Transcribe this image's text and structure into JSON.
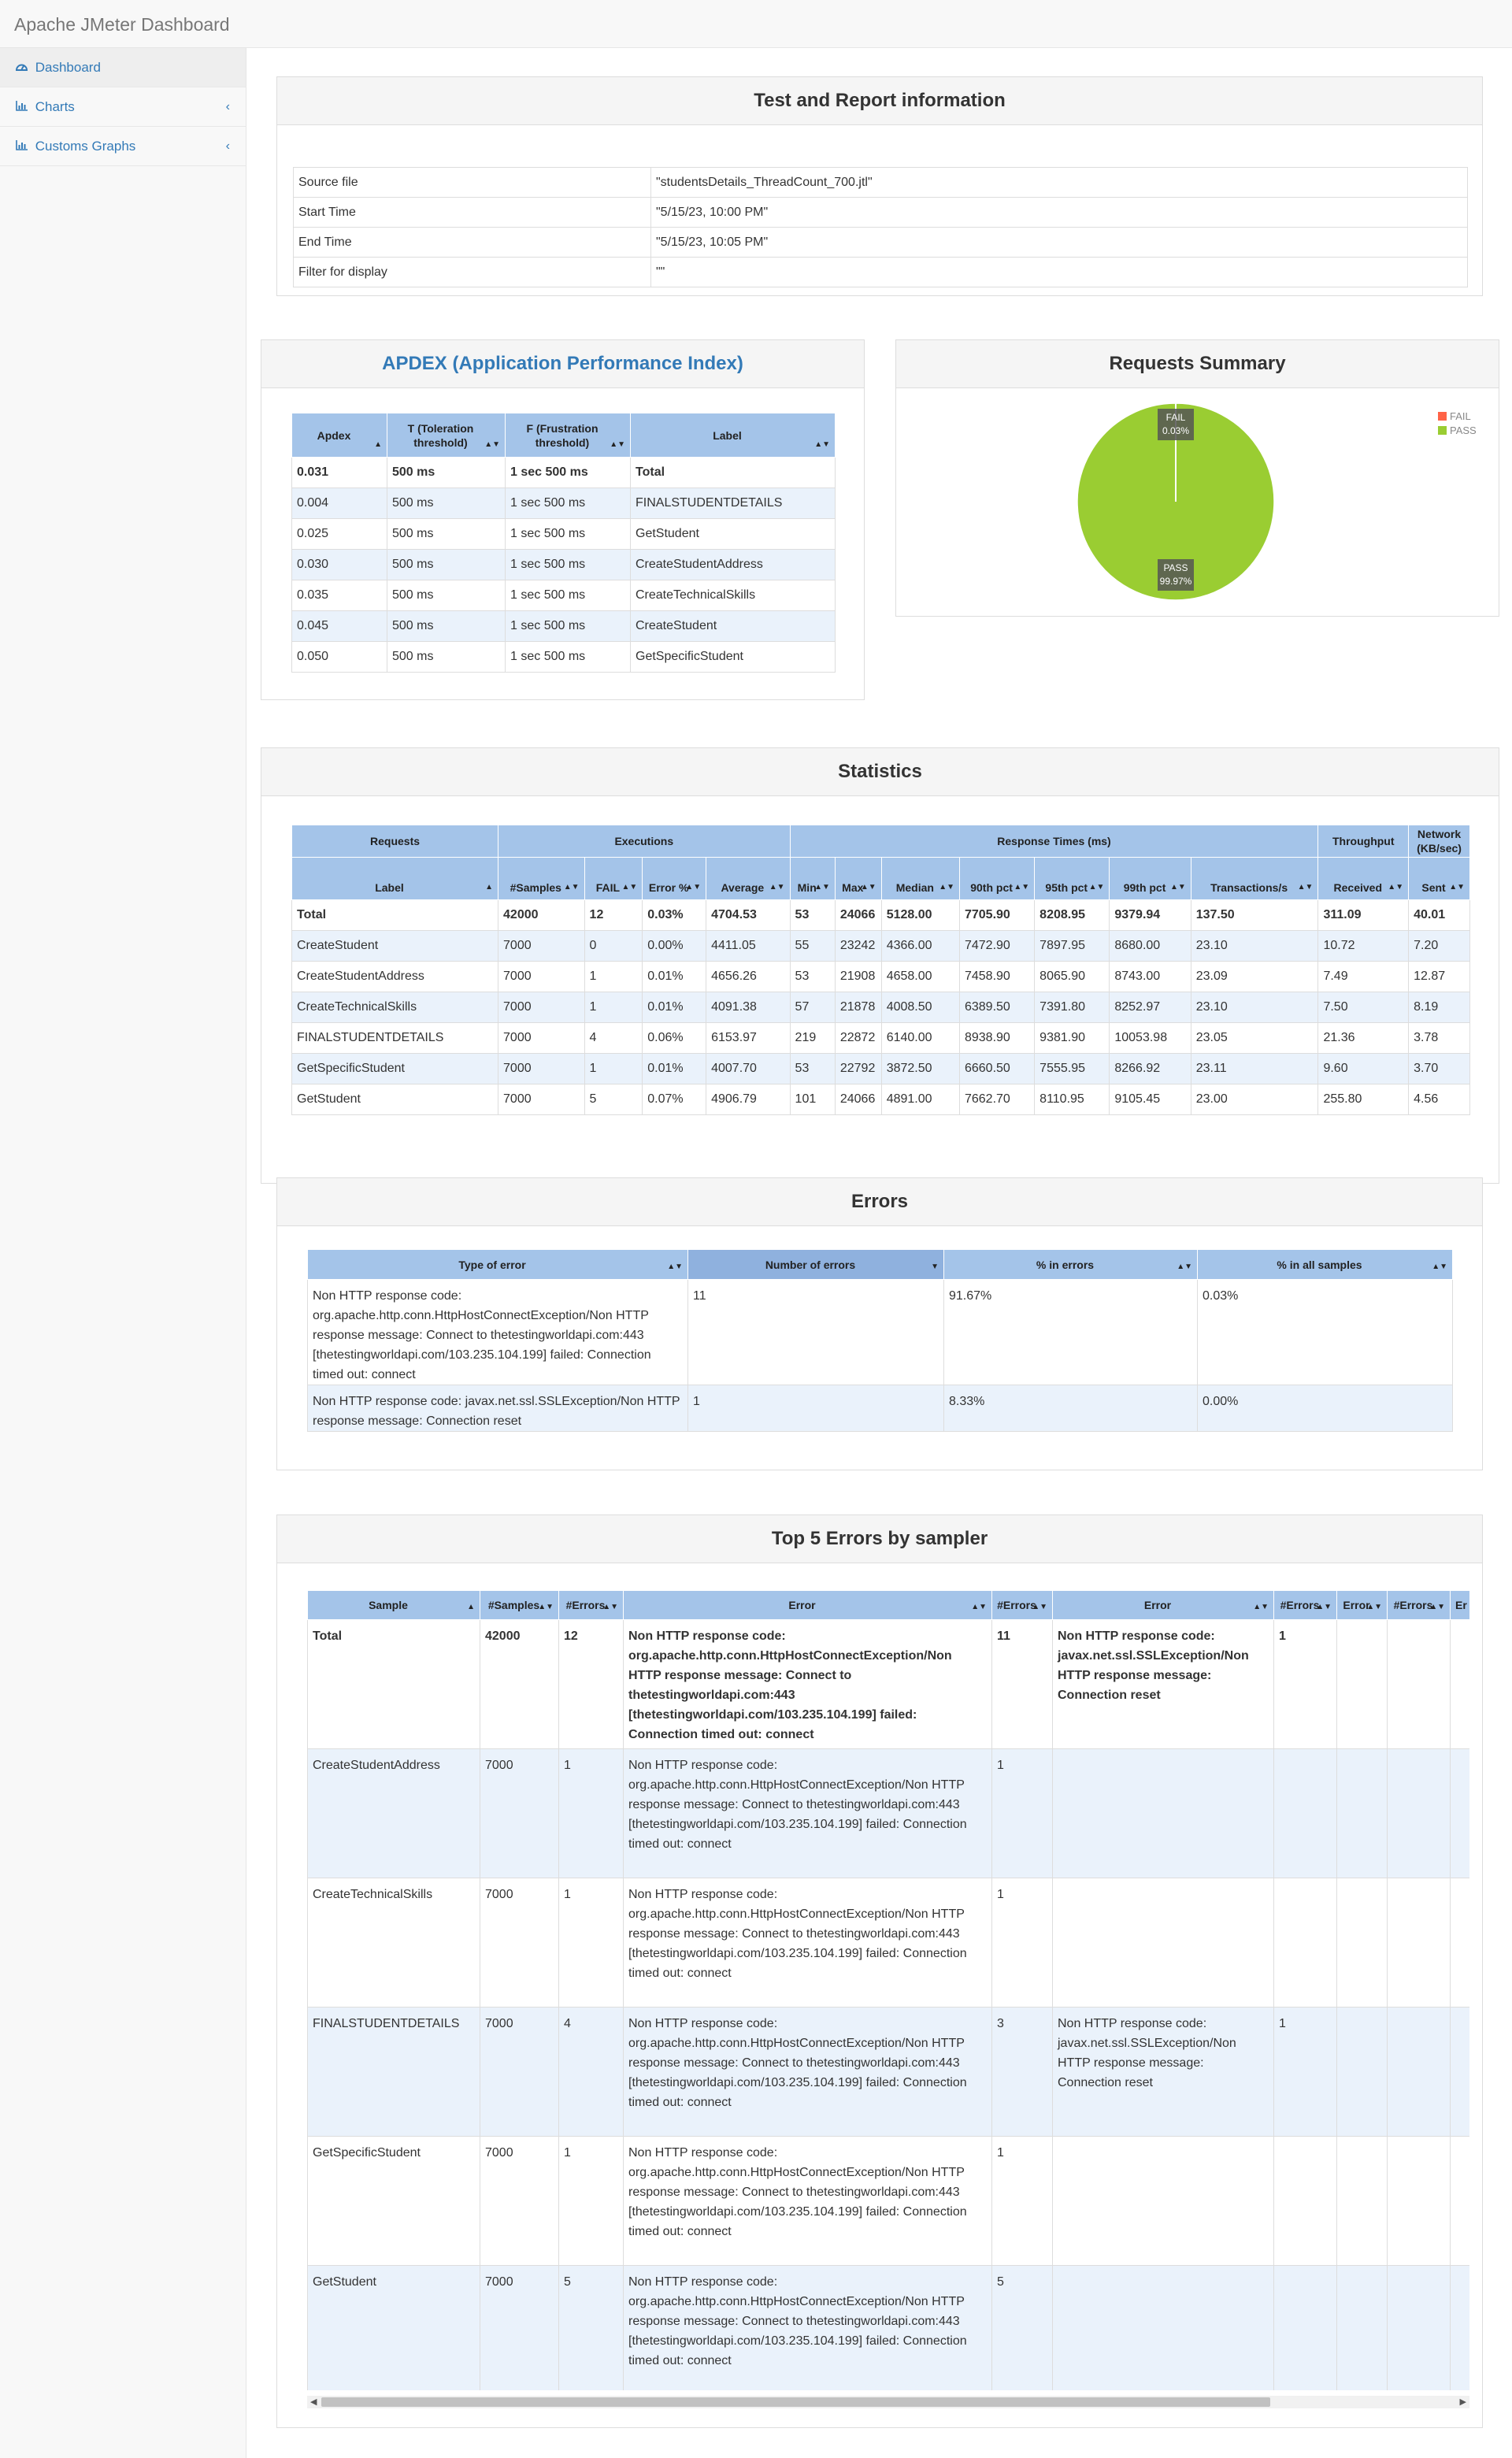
{
  "app": {
    "title": "Apache JMeter Dashboard"
  },
  "sidebar": {
    "items": [
      {
        "label": "Dashboard",
        "icon": "dashboard-icon",
        "active": true
      },
      {
        "label": "Charts",
        "icon": "bar-chart-icon"
      },
      {
        "label": "Customs Graphs",
        "icon": "bar-chart-icon"
      }
    ]
  },
  "report_info": {
    "title": "Test and Report information",
    "rows": [
      {
        "key": "Source file",
        "value": "\"studentsDetails_ThreadCount_700.jtl\""
      },
      {
        "key": "Start Time",
        "value": "\"5/15/23, 10:00 PM\""
      },
      {
        "key": "End Time",
        "value": "\"5/15/23, 10:05 PM\""
      },
      {
        "key": "Filter for display",
        "value": "\"\""
      }
    ]
  },
  "apdex": {
    "title": "APDEX (Application Performance Index)",
    "headers": [
      "Apdex",
      "T (Toleration threshold)",
      "F (Frustration threshold)",
      "Label"
    ],
    "rows": [
      [
        "0.031",
        "500 ms",
        "1 sec 500 ms",
        "Total"
      ],
      [
        "0.004",
        "500 ms",
        "1 sec 500 ms",
        "FINALSTUDENTDETAILS"
      ],
      [
        "0.025",
        "500 ms",
        "1 sec 500 ms",
        "GetStudent"
      ],
      [
        "0.030",
        "500 ms",
        "1 sec 500 ms",
        "CreateStudentAddress"
      ],
      [
        "0.035",
        "500 ms",
        "1 sec 500 ms",
        "CreateTechnicalSkills"
      ],
      [
        "0.045",
        "500 ms",
        "1 sec 500 ms",
        "CreateStudent"
      ],
      [
        "0.050",
        "500 ms",
        "1 sec 500 ms",
        "GetSpecificStudent"
      ]
    ]
  },
  "requests_summary": {
    "title": "Requests Summary",
    "colors": {
      "fail": "#ff6347",
      "pass": "#9acd32"
    },
    "labels": {
      "fail": "FAIL",
      "pass": "PASS",
      "fail_pct": "0.03%",
      "pass_pct": "99.97%"
    }
  },
  "chart_data": {
    "type": "pie",
    "title": "Requests Summary",
    "categories": [
      "FAIL",
      "PASS"
    ],
    "values": [
      0.03,
      99.97
    ],
    "legend": "top-right"
  },
  "statistics": {
    "title": "Statistics",
    "groups": [
      "Requests",
      "Executions",
      "Response Times (ms)",
      "Throughput",
      "Network (KB/sec)"
    ],
    "headers": [
      "Label",
      "#Samples",
      "FAIL",
      "Error %",
      "Average",
      "Min",
      "Max",
      "Median",
      "90th pct",
      "95th pct",
      "99th pct",
      "Transactions/s",
      "Received",
      "Sent"
    ],
    "rows": [
      [
        "Total",
        "42000",
        "12",
        "0.03%",
        "4704.53",
        "53",
        "24066",
        "5128.00",
        "7705.90",
        "8208.95",
        "9379.94",
        "137.50",
        "311.09",
        "40.01"
      ],
      [
        "CreateStudent",
        "7000",
        "0",
        "0.00%",
        "4411.05",
        "55",
        "23242",
        "4366.00",
        "7472.90",
        "7897.95",
        "8680.00",
        "23.10",
        "10.72",
        "7.20"
      ],
      [
        "CreateStudentAddress",
        "7000",
        "1",
        "0.01%",
        "4656.26",
        "53",
        "21908",
        "4658.00",
        "7458.90",
        "8065.90",
        "8743.00",
        "23.09",
        "7.49",
        "12.87"
      ],
      [
        "CreateTechnicalSkills",
        "7000",
        "1",
        "0.01%",
        "4091.38",
        "57",
        "21878",
        "4008.50",
        "6389.50",
        "7391.80",
        "8252.97",
        "23.10",
        "7.50",
        "8.19"
      ],
      [
        "FINALSTUDENTDETAILS",
        "7000",
        "4",
        "0.06%",
        "6153.97",
        "219",
        "22872",
        "6140.00",
        "8938.90",
        "9381.90",
        "10053.98",
        "23.05",
        "21.36",
        "3.78"
      ],
      [
        "GetSpecificStudent",
        "7000",
        "1",
        "0.01%",
        "4007.70",
        "53",
        "22792",
        "3872.50",
        "6660.50",
        "7555.95",
        "8266.92",
        "23.11",
        "9.60",
        "3.70"
      ],
      [
        "GetStudent",
        "7000",
        "5",
        "0.07%",
        "4906.79",
        "101",
        "24066",
        "4891.00",
        "7662.70",
        "8110.95",
        "9105.45",
        "23.00",
        "255.80",
        "4.56"
      ]
    ]
  },
  "errors": {
    "title": "Errors",
    "headers": [
      "Type of error",
      "Number of errors",
      "% in errors",
      "% in all samples"
    ],
    "rows": [
      [
        "Non HTTP response code: org.apache.http.conn.HttpHostConnectException/Non HTTP response message: Connect to thetestingworldapi.com:443 [thetestingworldapi.com/103.235.104.199] failed: Connection timed out: connect",
        "11",
        "91.67%",
        "0.03%"
      ],
      [
        "Non HTTP response code: javax.net.ssl.SSLException/Non HTTP response message: Connection reset",
        "1",
        "8.33%",
        "0.00%"
      ]
    ]
  },
  "top5": {
    "title": "Top 5 Errors by sampler",
    "headers": [
      "Sample",
      "#Samples",
      "#Errors",
      "Error",
      "#Errors",
      "Error",
      "#Errors",
      "Error",
      "#Errors",
      "Er"
    ],
    "rows": [
      [
        "Total",
        "42000",
        "12",
        "Non HTTP response code: org.apache.http.conn.HttpHostConnectException/Non HTTP response message: Connect to thetestingworldapi.com:443 [thetestingworldapi.com/103.235.104.199] failed: Connection timed out: connect",
        "11",
        "Non HTTP response code: javax.net.ssl.SSLException/Non HTTP response message: Connection reset",
        "1",
        "",
        "",
        ""
      ],
      [
        "CreateStudentAddress",
        "7000",
        "1",
        "Non HTTP response code: org.apache.http.conn.HttpHostConnectException/Non HTTP response message: Connect to thetestingworldapi.com:443 [thetestingworldapi.com/103.235.104.199] failed: Connection timed out: connect",
        "1",
        "",
        "",
        "",
        "",
        ""
      ],
      [
        "CreateTechnicalSkills",
        "7000",
        "1",
        "Non HTTP response code: org.apache.http.conn.HttpHostConnectException/Non HTTP response message: Connect to thetestingworldapi.com:443 [thetestingworldapi.com/103.235.104.199] failed: Connection timed out: connect",
        "1",
        "",
        "",
        "",
        "",
        ""
      ],
      [
        "FINALSTUDENTDETAILS",
        "7000",
        "4",
        "Non HTTP response code: org.apache.http.conn.HttpHostConnectException/Non HTTP response message: Connect to thetestingworldapi.com:443 [thetestingworldapi.com/103.235.104.199] failed: Connection timed out: connect",
        "3",
        "Non HTTP response code: javax.net.ssl.SSLException/Non HTTP response message: Connection reset",
        "1",
        "",
        "",
        ""
      ],
      [
        "GetSpecificStudent",
        "7000",
        "1",
        "Non HTTP response code: org.apache.http.conn.HttpHostConnectException/Non HTTP response message: Connect to thetestingworldapi.com:443 [thetestingworldapi.com/103.235.104.199] failed: Connection timed out: connect",
        "1",
        "",
        "",
        "",
        "",
        ""
      ],
      [
        "GetStudent",
        "7000",
        "5",
        "Non HTTP response code: org.apache.http.conn.HttpHostConnectException/Non HTTP response message: Connect to thetestingworldapi.com:443 [thetestingworldapi.com/103.235.104.199] failed: Connection timed out: connect",
        "5",
        "",
        "",
        "",
        "",
        ""
      ]
    ]
  }
}
